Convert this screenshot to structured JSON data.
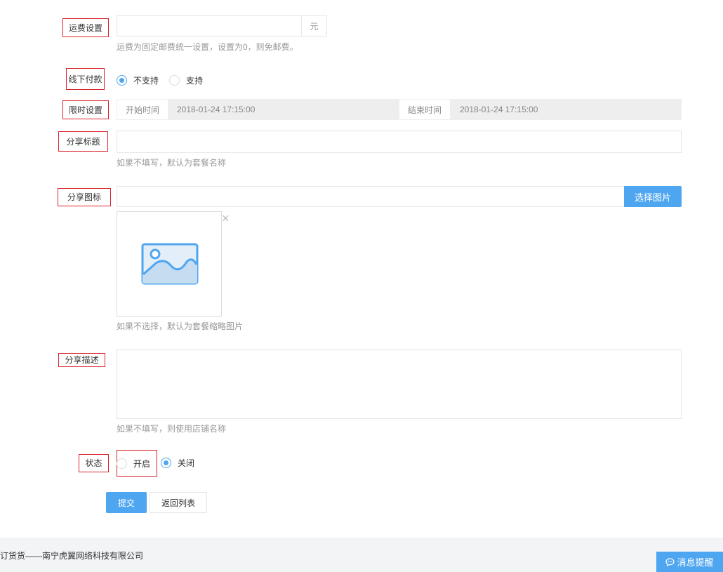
{
  "shipping": {
    "label": "运费设置",
    "value": "",
    "unit": "元",
    "help": "运费为固定邮费统一设置，设置为0，则免邮费。"
  },
  "offline_payment": {
    "label": "线下付款",
    "options": [
      "不支持",
      "支持"
    ],
    "selected": "不支持"
  },
  "time_limit": {
    "label": "限时设置",
    "start_label": "开始时间",
    "start_value": "2018-01-24 17:15:00",
    "end_label": "结束时间",
    "end_value": "2018-01-24 17:15:00"
  },
  "share_title": {
    "label": "分享标题",
    "value": "",
    "help": "如果不填写，默认为套餐名称"
  },
  "share_icon": {
    "label": "分享图标",
    "value": "",
    "button": "选择图片",
    "remove": "×",
    "help": "如果不选择，默认为套餐缩略图片"
  },
  "share_desc": {
    "label": "分享描述",
    "value": "",
    "help": "如果不填写，则使用店铺名称"
  },
  "status": {
    "label": "状态",
    "options": [
      "开启",
      "关闭"
    ],
    "selected": "关闭"
  },
  "actions": {
    "submit": "提交",
    "back": "返回列表"
  },
  "footer": {
    "text": "订货货——南宁虎翼网络科技有限公司",
    "notify": "消息提醒"
  },
  "colors": {
    "accent": "#4fa6f0",
    "highlight_border": "#d9232d"
  }
}
